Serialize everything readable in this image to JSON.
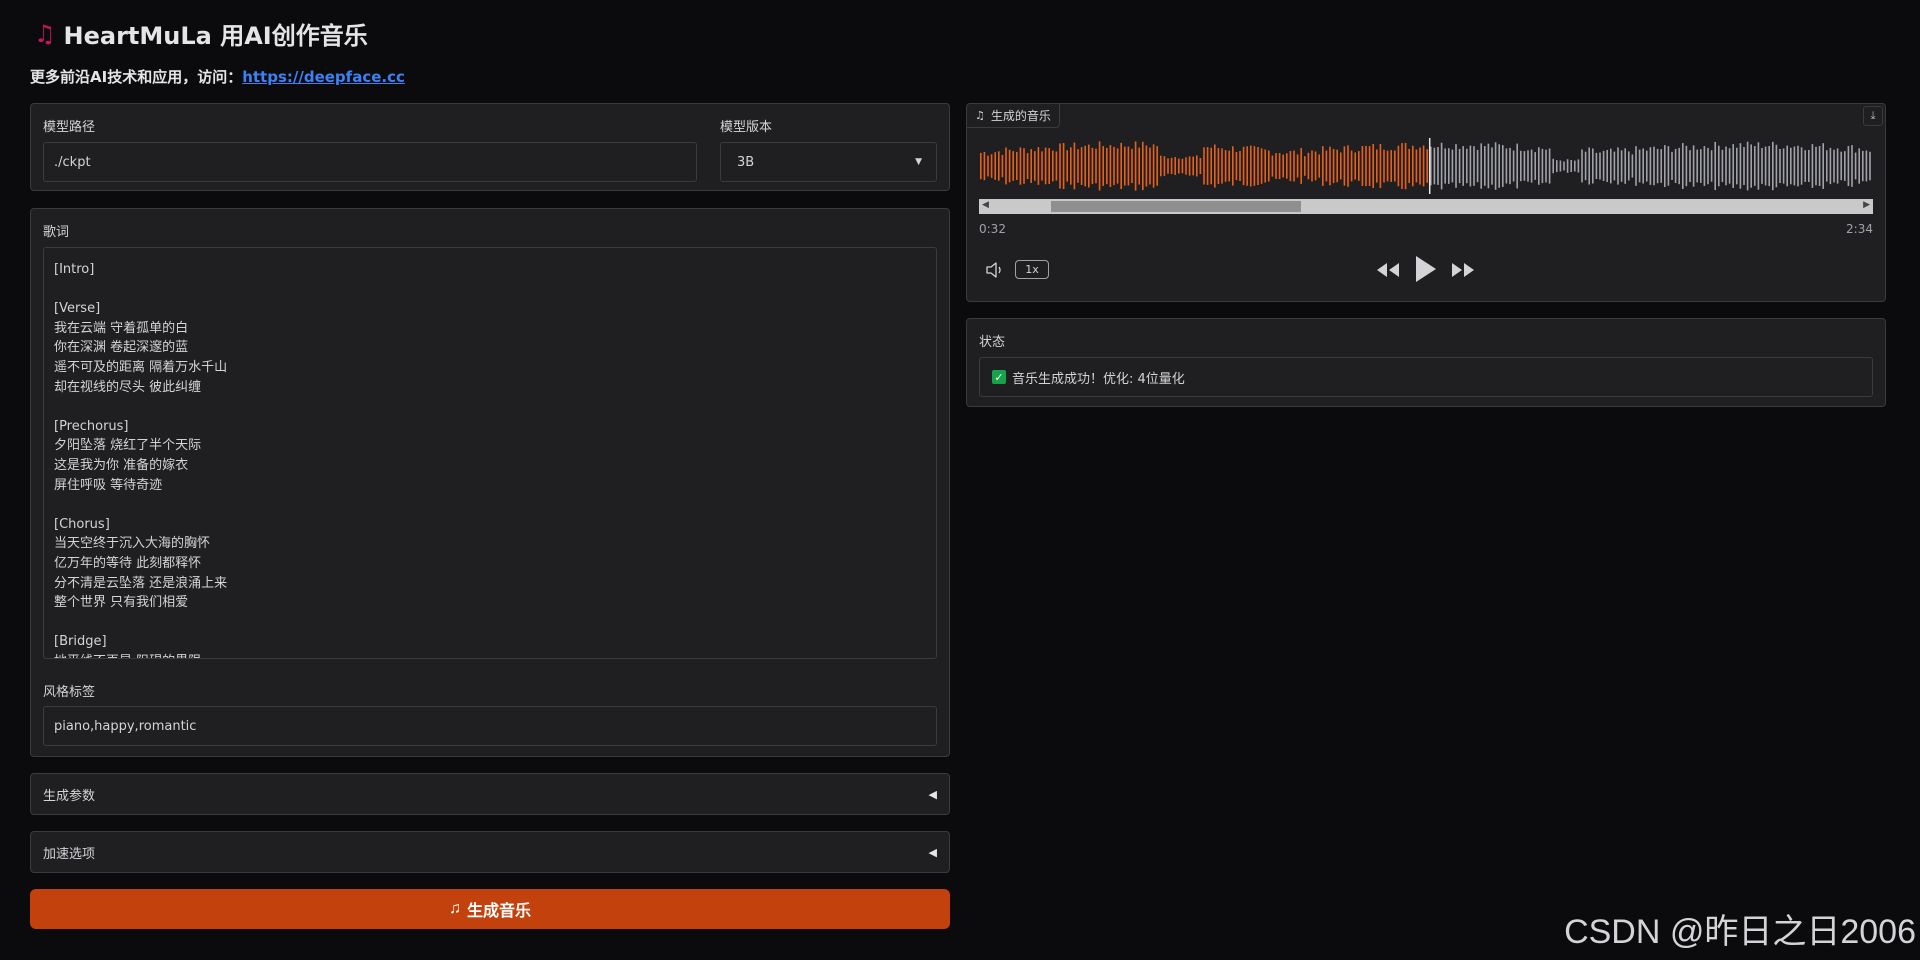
{
  "header": {
    "title": "HeartMuLa 用AI创作音乐",
    "subtitle_prefix": "更多前沿AI技术和应用，访问：",
    "subtitle_link": "https://deepface.cc"
  },
  "model": {
    "path_label": "模型路径",
    "path_value": "./ckpt",
    "version_label": "模型版本",
    "version_value": "3B"
  },
  "lyrics": {
    "label": "歌词",
    "value": "[Intro]\n\n[Verse]\n我在云端 守着孤单的白\n你在深渊 卷起深邃的蓝\n遥不可及的距离 隔着万水千山\n却在视线的尽头 彼此纠缠\n\n[Prechorus]\n夕阳坠落 烧红了半个天际\n这是我为你 准备的嫁衣\n屏住呼吸 等待奇迹\n\n[Chorus]\n当天空终于沉入大海的胸怀\n亿万年的等待 此刻都释怀\n分不清是云坠落 还是浪涌上来\n整个世界 只有我们相爱\n\n[Bridge]\n地平线不再是 阻碍的界限"
  },
  "style": {
    "label": "风格标签",
    "value": "piano,happy,romantic"
  },
  "accordions": {
    "gen_params": "生成参数",
    "accel": "加速选项",
    "arrow": "◀"
  },
  "generate_button": "生成音乐",
  "audio": {
    "label": "生成的音乐",
    "current_time": "0:32",
    "total_time": "2:34",
    "speed": "1x",
    "played_fraction": 0.503,
    "played_color": "#e8601c",
    "unplayed_color": "#a1a1aa"
  },
  "status": {
    "label": "状态",
    "message": "音乐生成成功！优化: 4位量化"
  },
  "watermark": "CSDN @昨日之日2006",
  "icons": {
    "title": "music-note-icon",
    "audio_tag": "music-note-icon",
    "download": "download-icon",
    "volume": "volume-icon",
    "rewind": "rewind-icon",
    "play": "play-icon",
    "forward": "fast-forward-icon",
    "check": "checkbox-checked-icon",
    "dropdown": "dropdown-caret-icon"
  }
}
